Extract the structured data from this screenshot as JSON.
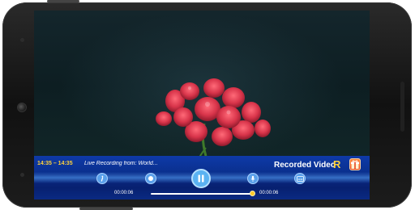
{
  "video": {
    "progress_fraction": 1.0
  },
  "controls": {
    "time_range": "14:35 – 14:35",
    "live_text": "Live Recording from: World...",
    "recorded_label": "Recorded Video",
    "recorded_letter": "R",
    "current_time": "00:00:06",
    "total_time": "00:00:06"
  },
  "colors": {
    "bar_blue": "#0a2f8c",
    "accent_yellow": "#ffd23a",
    "button_blue": "#5aa0ea",
    "flower_red": "#d8344a"
  },
  "icons": {
    "info": "info-icon",
    "record": "record-dot-icon",
    "play_pause": "pause-icon",
    "mic": "microphone-icon",
    "subtitles": "subtitles-icon",
    "gift": "gift-icon"
  }
}
